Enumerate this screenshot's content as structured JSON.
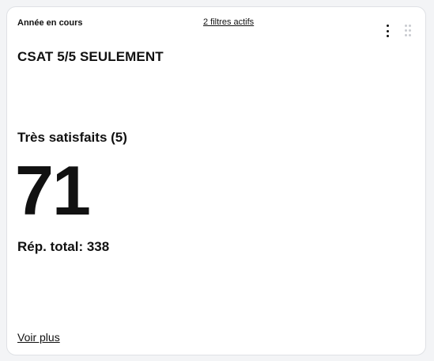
{
  "widget": {
    "period_label": "Année en cours",
    "filters_link": "2  filtres actifs",
    "title": "CSAT 5/5 SEULEMENT",
    "metric_label": "Très satisfaits (5)",
    "metric_value": "71",
    "total_label": "Rép. total: 338",
    "see_more_link": "Voir plus"
  },
  "icons": {
    "menu": "more-vertical-icon",
    "drag": "drag-handle-icon"
  },
  "colors": {
    "background": "#f3f4f6",
    "card": "#ffffff",
    "text": "#111111",
    "drag_handle": "#c9cbd0"
  }
}
